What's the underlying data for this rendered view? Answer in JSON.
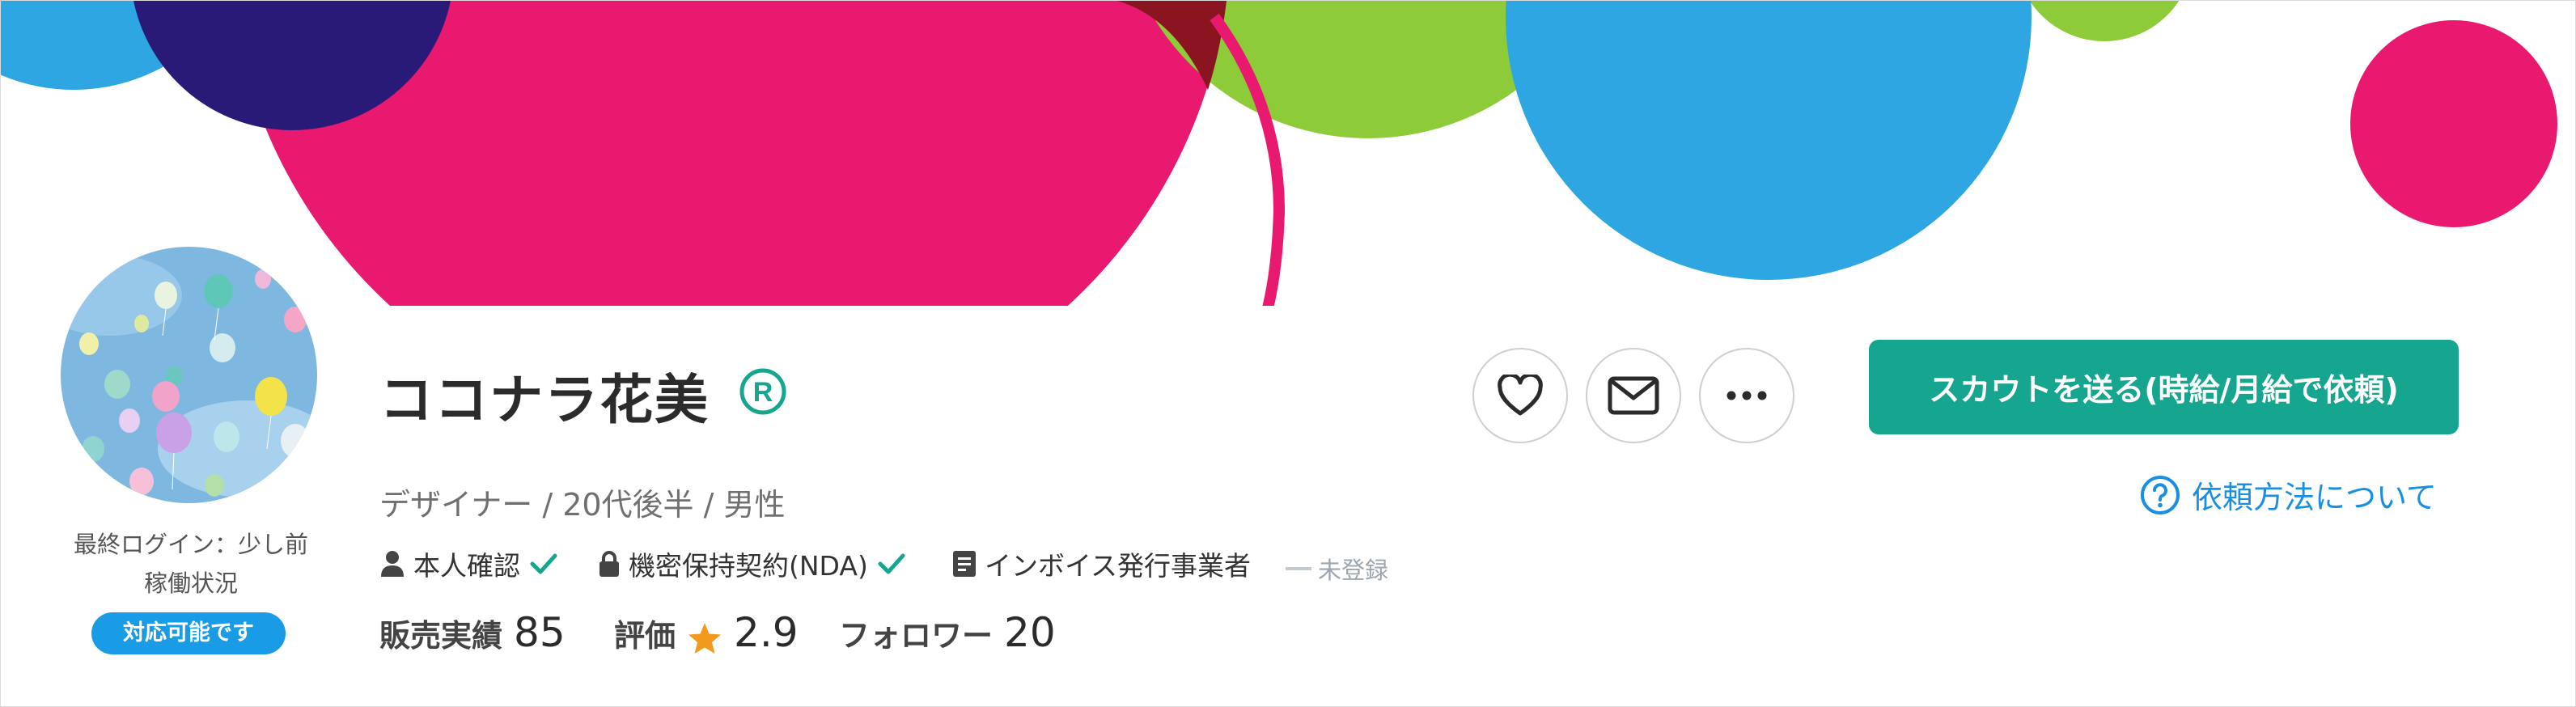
{
  "profile": {
    "name": "ココナラ花美",
    "registered_mark": "R",
    "subtitle": "デザイナー / 20代後半 / 男性"
  },
  "status": {
    "last_login": "最終ログイン：少し前",
    "activity_label": "稼働状況",
    "availability_badge": "対応可能です"
  },
  "verifications": {
    "identity": "本人確認",
    "nda": "機密保持契約(NDA)",
    "invoice": "インボイス発行事業者",
    "invoice_status": "未登録"
  },
  "stats": {
    "sales_label": "販売実績",
    "sales_value": "85",
    "rating_label": "評価",
    "rating_value": "2.9",
    "followers_label": "フォロワー",
    "followers_value": "20"
  },
  "actions": {
    "scout_button": "スカウトを送る(時給/月給で依頼)",
    "how_to_request": "依頼方法について"
  },
  "icons": {
    "favorite": "heart-icon",
    "message": "envelope-icon",
    "more": "more-dots-icon",
    "help": "question-circle-icon",
    "rating": "star-icon",
    "user": "person-icon",
    "lock": "lock-icon",
    "document": "document-icon",
    "check": "check-icon"
  },
  "colors": {
    "accent_green": "#16a58e",
    "badge_blue": "#1a9be6",
    "link_blue": "#1a8fe0",
    "star_orange": "#f39a1e",
    "cover_pink": "#e8196f",
    "cover_green": "#8dcc38",
    "cover_blue": "#2ea6e1",
    "cover_navy": "#2a1a78",
    "cover_maroon": "#8a1520"
  }
}
